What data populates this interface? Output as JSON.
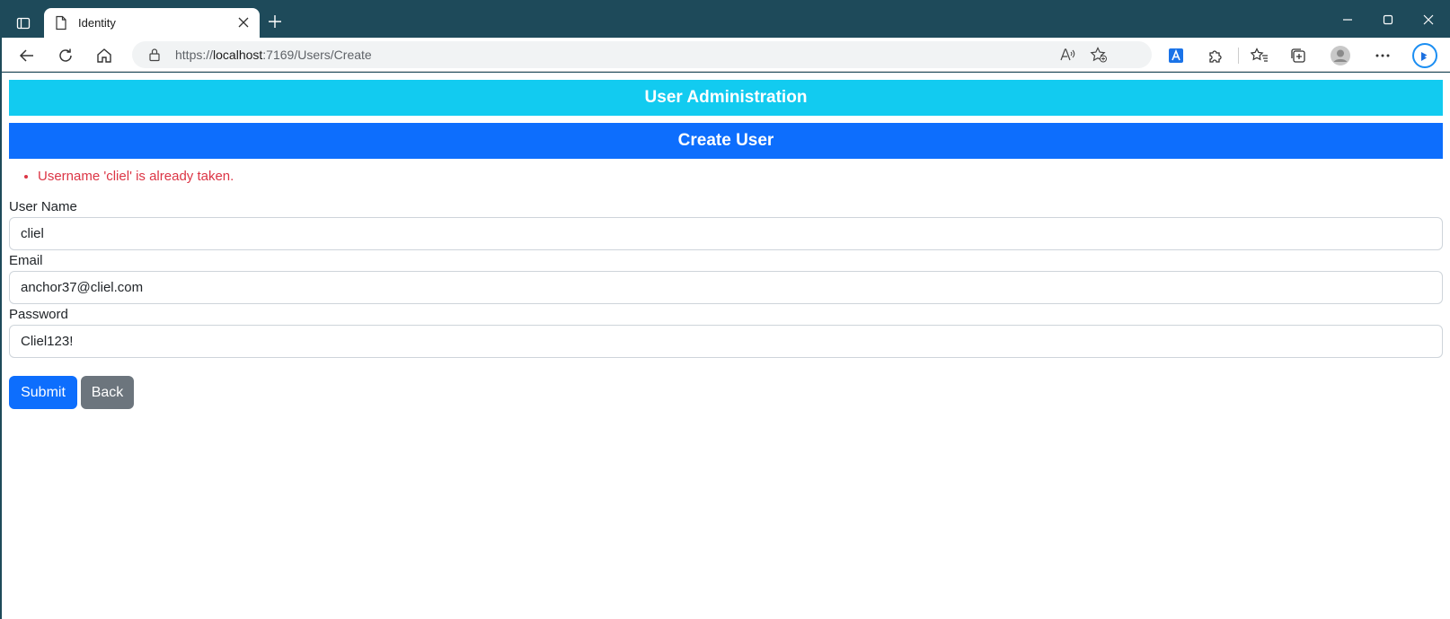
{
  "browser": {
    "tab": {
      "title": "Identity"
    },
    "address": {
      "scheme": "https://",
      "host": "localhost",
      "rest": ":7169/Users/Create"
    },
    "icons": {
      "sidebar": "sidebar-icon",
      "tab": "page-icon",
      "close": "close-icon",
      "new_tab": "plus-icon",
      "minimize": "minimize-icon",
      "maximize": "maximize-icon",
      "window_close": "close-icon",
      "back": "arrow-left-icon",
      "refresh": "refresh-icon",
      "home": "home-icon",
      "lock": "lock-icon",
      "read_aloud": "read-aloud-icon",
      "favorite_add": "star-add-icon",
      "translate": "translate-icon",
      "extensions": "puzzle-icon",
      "favorites": "favorites-icon",
      "collections": "collections-icon",
      "profile": "profile-icon",
      "more": "more-icon",
      "copilot": "bing-icon"
    }
  },
  "page": {
    "admin_banner": "User Administration",
    "create_banner": "Create User",
    "errors": [
      "Username 'cliel' is already taken."
    ],
    "fields": {
      "username": {
        "label": "User Name",
        "value": "cliel"
      },
      "email": {
        "label": "Email",
        "value": "anchor37@cliel.com"
      },
      "password": {
        "label": "Password",
        "value": "Cliel123!"
      }
    },
    "buttons": {
      "submit": "Submit",
      "back": "Back"
    }
  },
  "colors": {
    "chrome": "#1e4a5a",
    "admin_banner": "#12cbf0",
    "create_banner": "#0d6efd",
    "error": "#dc3545",
    "submit": "#0d6efd",
    "back": "#6c757d"
  }
}
